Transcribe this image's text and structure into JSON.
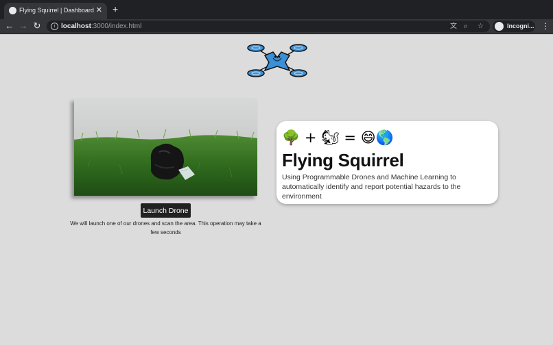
{
  "browser": {
    "tab": {
      "title": "Flying Squirrel | Dashboard",
      "close": "✕"
    },
    "new_tab": "+",
    "nav": {
      "back": "←",
      "forward": "→",
      "reload": "↻"
    },
    "url": {
      "host": "localhost",
      "rest": ":3000/index.html"
    },
    "omnibox_icons": {
      "translate": "文",
      "zoom": "⌕",
      "bookmark": "☆"
    },
    "profile": {
      "label": "Incogni..."
    },
    "menu": "⋮"
  },
  "hero": {
    "launch_button": "Launch Drone",
    "launch_note": "We will launch one of our drones and scan the area. This operation may take a few seconds"
  },
  "card": {
    "equation": "🌳 + 🐿 = 😄🌎",
    "title": "Flying Squirrel",
    "description": "Using Programmable Drones and Machine Learning to automatically identify and report potential hazards to the environment"
  },
  "colors": {
    "page_bg": "#dcdcdc",
    "tabbar_bg": "#202124",
    "toolbar_bg": "#35363a",
    "button_bg": "#212121",
    "logo_blue": "#3a8fd6"
  }
}
